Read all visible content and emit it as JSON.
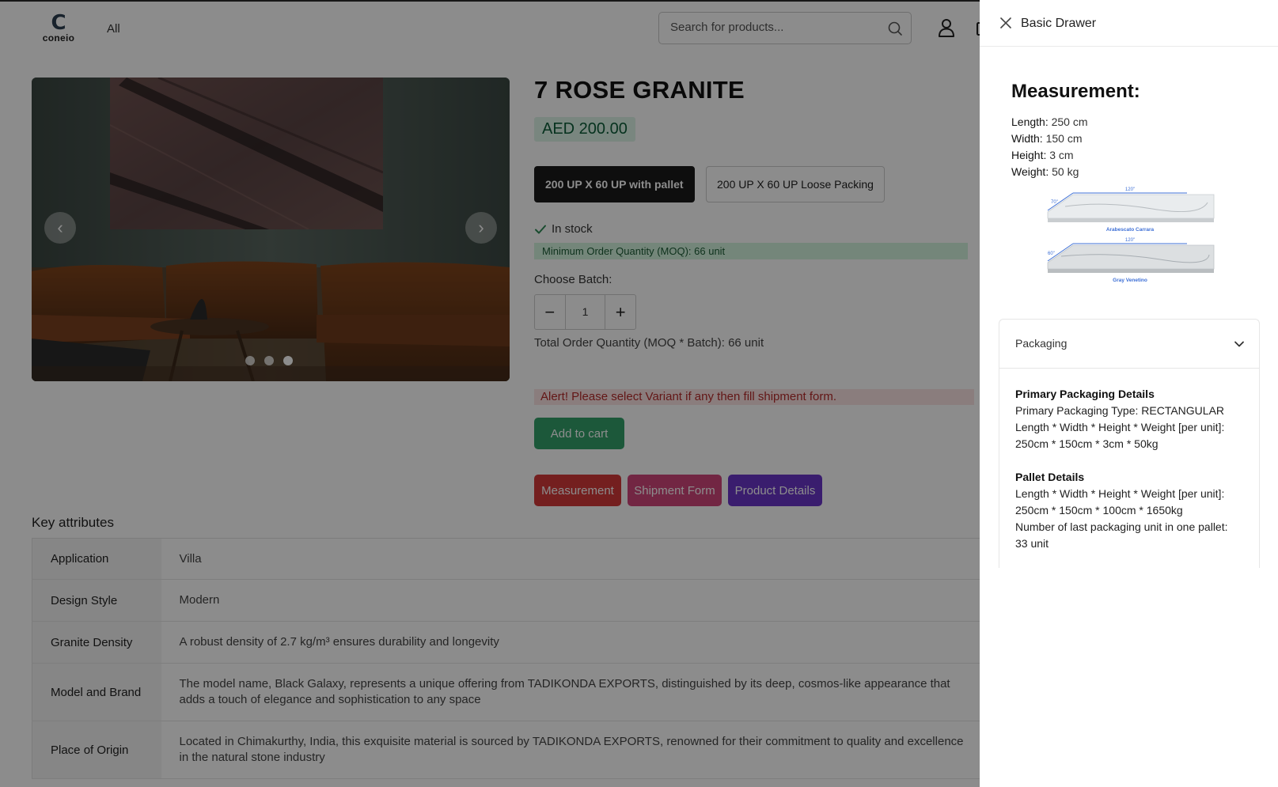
{
  "header": {
    "logo_mark": "C",
    "logo_text": "coneio",
    "nav_all": "All",
    "search_placeholder": "Search for products..."
  },
  "product": {
    "title": "7 ROSE GRANITE",
    "price": "AED 200.00",
    "variants": [
      "200 UP X 60 UP with pallet",
      "200 UP X 60 UP Loose Packing"
    ],
    "stock": "In stock",
    "moq": "Minimum Order Quantity (MOQ): 66 unit",
    "choose_batch": "Choose Batch:",
    "batch_value": "1",
    "total": "Total Order Quantity (MOQ * Batch): 66 unit",
    "alert": "Alert! Please select Variant if any then fill shipment form.",
    "add_to_cart": "Add to cart",
    "tabs": [
      "Measurement",
      "Shipment Form",
      "Product Details"
    ],
    "gallery_active_slide": 3,
    "gallery_total_slides": 3
  },
  "key_attributes": {
    "title": "Key attributes",
    "rows": [
      {
        "key": "Application",
        "value": "Villa"
      },
      {
        "key": "Design Style",
        "value": "Modern"
      },
      {
        "key": "Granite Density",
        "value": "A robust density of 2.7 kg/m³ ensures durability and longevity"
      },
      {
        "key": "Model and Brand",
        "value": "The model name, Black Galaxy, represents a unique offering from TADIKONDA EXPORTS, distinguished by its deep, cosmos-like appearance that adds a touch of elegance and sophistication to any space"
      },
      {
        "key": "Place of Origin",
        "value": "Located in Chimakurthy, India, this exquisite material is sourced by TADIKONDA EXPORTS, renowned for their commitment to quality and excellence in the natural stone industry"
      }
    ]
  },
  "drawer": {
    "title": "Basic Drawer",
    "heading": "Measurement:",
    "measurements": [
      {
        "label": "Length:",
        "value": "250 cm"
      },
      {
        "label": "Width:",
        "value": "150 cm"
      },
      {
        "label": "Height:",
        "value": "3 cm"
      },
      {
        "label": "Weight:",
        "value": "50 kg"
      }
    ],
    "diagram": {
      "top_dim_1": "120\"",
      "side_dim_1": "70\"",
      "label_1": "Arabescato Carrara",
      "top_dim_2": "120\"",
      "side_dim_2": "60\"",
      "label_2": "Gray Venetino"
    },
    "packaging": {
      "title": "Packaging",
      "primary_heading": "Primary Packaging Details",
      "primary_type_label": "Primary Packaging Type:",
      "primary_type_value": "RECTANGULAR",
      "primary_dims_label": "Length * Width * Height * Weight [per unit]:",
      "primary_dims_value": "250cm * 150cm * 3cm * 50kg",
      "pallet_heading": "Pallet Details",
      "pallet_dims_label": "Length * Width * Height * Weight [per unit]:",
      "pallet_dims_value": "250cm * 150cm * 100cm * 1650kg",
      "pallet_count_label": "Number of last packaging unit in one pallet:",
      "pallet_count_value": "33 unit"
    }
  },
  "colors": {
    "overlay": "#000000",
    "add_to_cart": "#34a16b",
    "measurement_tab": "#d3393a",
    "shipment_tab": "#d0467b",
    "details_tab": "#6a35c9",
    "price_bg": "#dcf5e7",
    "alert_bg": "#fbe3e3"
  }
}
